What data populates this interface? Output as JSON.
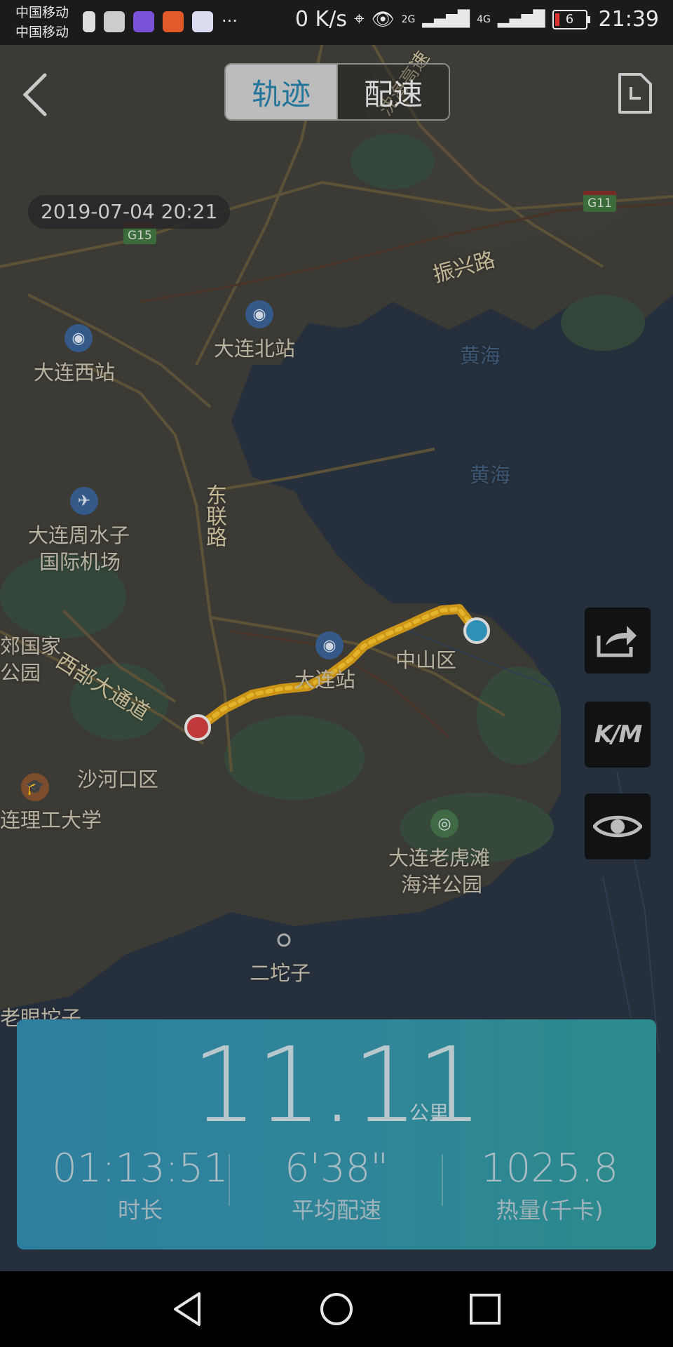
{
  "status_bar": {
    "carrier_1": "中国移动",
    "carrier_2": "中国移动",
    "more": "···",
    "net_speed": "0 K/s",
    "signal_1": "2G",
    "signal_2": "4G",
    "battery_level": "6",
    "time": "21:39"
  },
  "header": {
    "tabs": [
      {
        "label": "轨迹",
        "active": true
      },
      {
        "label": "配速",
        "active": false
      }
    ],
    "datetime": "2019-07-04 20:21"
  },
  "map": {
    "labels": {
      "dalian_west": "大连西站",
      "dalian_north": "大连北站",
      "yellow_sea_1": "黄海",
      "yellow_sea_2": "黄海",
      "airport_1": "大连周水子",
      "airport_2": "国际机场",
      "park_1": "郊国家",
      "park_2": "公园",
      "dalian_station": "大连站",
      "zhongshan": "中山区",
      "shahekou": "沙河口区",
      "university": "连理工大学",
      "tiger_beach_1": "大连老虎滩",
      "tiger_beach_2": "海洋公园",
      "ertuozi": "二坨子",
      "laohutuozi": "老眼坨子"
    },
    "roads": {
      "zhenxing": "振兴路",
      "donglian": "东联路",
      "xibu": "西部大通道",
      "shenhai": "沈海高速"
    },
    "highway_signs": {
      "g15": "G15",
      "g11": "G11"
    },
    "route_colors": {
      "track": "#d9a21a",
      "start": "#2f8fb5",
      "end": "#c0393b"
    }
  },
  "tools": {
    "share_icon": "share-icon",
    "unit_label": "K/M",
    "visibility_icon": "eye-icon"
  },
  "summary": {
    "distance": "11.11",
    "distance_unit": "公里",
    "stats": [
      {
        "value": "01:13:51",
        "label": "时长"
      },
      {
        "value": "6'38\"",
        "label": "平均配速"
      },
      {
        "value": "1025.8",
        "label": "热量(千卡)"
      }
    ]
  },
  "navigation": {
    "back_icon": "triangle-back-icon",
    "home_icon": "circle-home-icon",
    "recents_icon": "square-recents-icon"
  }
}
